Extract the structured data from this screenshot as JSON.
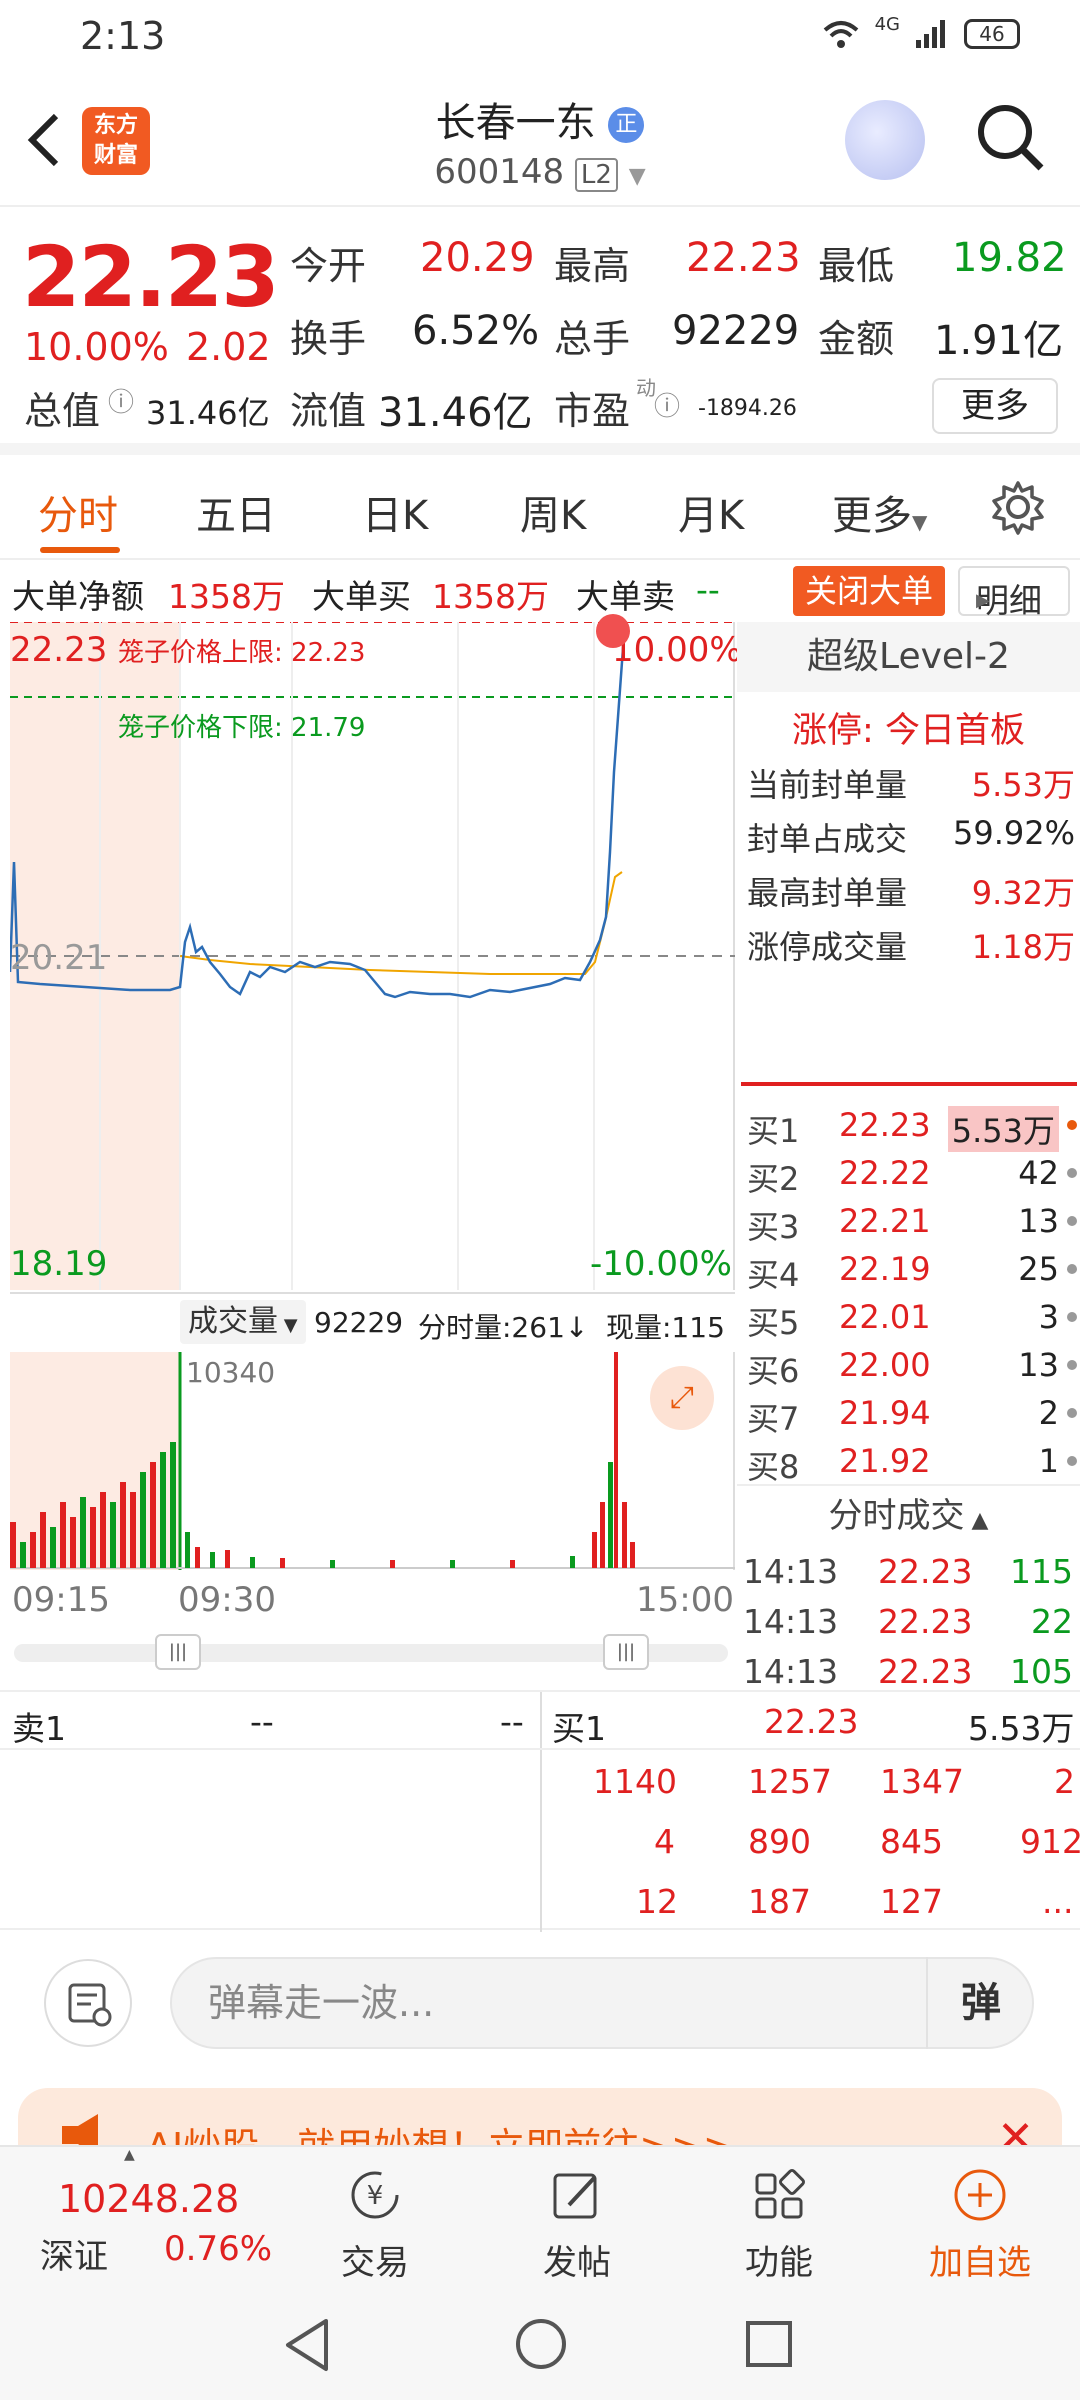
{
  "status": {
    "time": "2:13",
    "network": "4G",
    "battery": "46"
  },
  "header": {
    "name": "长春一东",
    "badge": "正",
    "code": "600148",
    "level": "L2",
    "logo_line1": "东方",
    "logo_line2": "财富"
  },
  "quote": {
    "price": "22.23",
    "pct": "10.00%",
    "change": "2.02",
    "open_label": "今开",
    "open": "20.29",
    "high_label": "最高",
    "high": "22.23",
    "low_label": "最低",
    "low": "19.82",
    "turnover_label": "换手",
    "turnover": "6.52%",
    "volume_label": "总手",
    "volume": "92229",
    "amount_label": "金额",
    "amount": "1.91亿",
    "mktcap_label": "总值",
    "mktcap": "31.46亿",
    "float_label": "流值",
    "float": "31.46亿",
    "pe_label": "市盈",
    "pe_sup": "动",
    "pe": "-1894.26",
    "more": "更多"
  },
  "tabs": [
    "分时",
    "五日",
    "日K",
    "周K",
    "月K",
    "更多"
  ],
  "bigorder": {
    "net_label": "大单净额",
    "net": "1358万",
    "buy_label": "大单买",
    "buy": "1358万",
    "sell_label": "大单卖",
    "sell": "--",
    "close_btn": "关闭大单",
    "detail_btn": "明细"
  },
  "chart": {
    "top_price": "22.23",
    "top_pct": "10.00%",
    "ref_price": "20.21",
    "bottom_price": "18.19",
    "bottom_pct": "-10.00%",
    "cage_upper": "笼子价格上限:  22.23",
    "cage_lower": "笼子价格下限:  21.79",
    "vol_label": "成交量",
    "vol_total": "92229",
    "vol_minute": "分时量:261↓",
    "vol_now": "现量:115",
    "vol_max": "10340",
    "t_start": "09:15",
    "t_open": "09:30",
    "t_end": "15:00"
  },
  "level2": {
    "title": "超级Level-2",
    "head": "涨停: 今日首板",
    "stats": [
      {
        "k": "当前封单量",
        "v": "5.53万"
      },
      {
        "k": "封单占成交",
        "v": "59.92%"
      },
      {
        "k": "最高封单量",
        "v": "9.32万"
      },
      {
        "k": "涨停成交量",
        "v": "1.18万"
      }
    ],
    "bids": [
      {
        "l": "买1",
        "p": "22.23",
        "q": "5.53万"
      },
      {
        "l": "买2",
        "p": "22.22",
        "q": "42"
      },
      {
        "l": "买3",
        "p": "22.21",
        "q": "13"
      },
      {
        "l": "买4",
        "p": "22.19",
        "q": "25"
      },
      {
        "l": "买5",
        "p": "22.01",
        "q": "3"
      },
      {
        "l": "买6",
        "p": "22.00",
        "q": "13"
      },
      {
        "l": "买7",
        "p": "21.94",
        "q": "2"
      },
      {
        "l": "买8",
        "p": "21.92",
        "q": "1"
      }
    ],
    "ticks_title": "分时成交",
    "ticks": [
      {
        "t": "14:13",
        "p": "22.23",
        "v": "115"
      },
      {
        "t": "14:13",
        "p": "22.23",
        "v": "22"
      },
      {
        "t": "14:13",
        "p": "22.23",
        "v": "105"
      }
    ]
  },
  "book": {
    "sell_label": "卖1",
    "sell_price": "--",
    "sell_qty": "--",
    "buy_label": "买1",
    "buy_price": "22.23",
    "buy_qty": "5.53万",
    "queue": [
      [
        "1140",
        "1257",
        "1347",
        "2"
      ],
      [
        "4",
        "890",
        "845",
        "912"
      ],
      [
        "12",
        "187",
        "127",
        "..."
      ]
    ]
  },
  "comment": {
    "placeholder": "弹幕走一波...",
    "send": "弹"
  },
  "banner": {
    "text": "AI炒股，就用妙想！立即前往>>>"
  },
  "nav": {
    "index_value": "10248.28",
    "index_name": "深证",
    "index_pct": "0.76%",
    "items": [
      "交易",
      "发帖",
      "功能",
      "加自选"
    ]
  }
}
